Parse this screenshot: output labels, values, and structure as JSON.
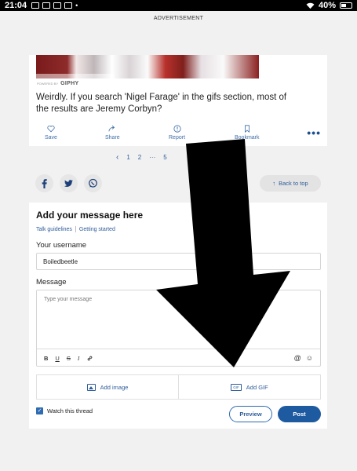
{
  "status_bar": {
    "time": "21:04",
    "battery": "40%"
  },
  "ad_label": "ADVERTISEMENT",
  "post": {
    "giphy_powered": "POWERED BY",
    "giphy_logo": "GIPHY",
    "text": "Weirdly. If you search 'Nigel Farage' in the gifs section, most of the results are Jeremy Corbyn?",
    "actions": [
      {
        "label": "Save",
        "icon": "heart-icon"
      },
      {
        "label": "Share",
        "icon": "share-arrow-icon"
      },
      {
        "label": "Report",
        "icon": "report-icon"
      },
      {
        "label": "Bookmark",
        "icon": "bookmark-icon"
      }
    ],
    "more_label": "•••"
  },
  "pagination": {
    "prev": "‹",
    "pages": [
      "1",
      "2"
    ],
    "ellipsis": "···",
    "last": "5"
  },
  "share_icons": [
    "facebook-icon",
    "twitter-icon",
    "whatsapp-icon"
  ],
  "back_to_top": {
    "label": "Back to top",
    "icon": "↑"
  },
  "reply": {
    "title": "Add your message here",
    "links": [
      "Talk guidelines",
      "Getting started"
    ],
    "username_label": "Your username",
    "username_value": "Boiledbeetle",
    "message_label": "Message",
    "message_placeholder": "Type your message",
    "format": {
      "bold": "B",
      "underline": "U",
      "strike": "S",
      "italic": "I",
      "link": "🔗",
      "mention": "@",
      "emoji": "☺"
    },
    "add_image": "Add image",
    "add_gif": "Add GIF",
    "gif_badge": "GIF",
    "watch_label": "Watch this thread",
    "watch_checked": "✓",
    "preview_label": "Preview",
    "post_label": "Post"
  },
  "colors": {
    "accent": "#1e5aa0",
    "link": "#2e5c9a",
    "page_bg": "#f1f1f1"
  }
}
